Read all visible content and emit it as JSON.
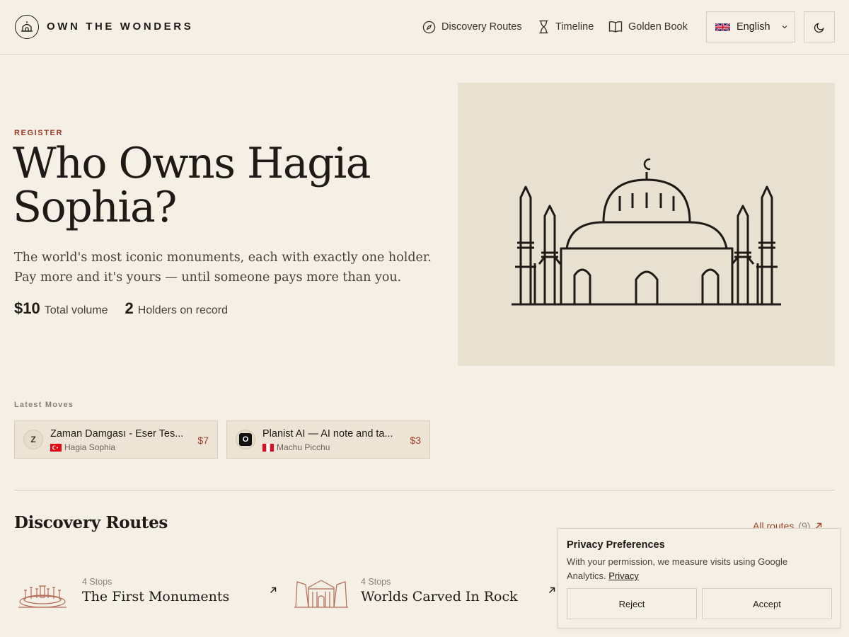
{
  "header": {
    "brand": "OWN THE WONDERS",
    "nav": [
      {
        "label": "Discovery Routes",
        "icon": "compass-icon"
      },
      {
        "label": "Timeline",
        "icon": "hourglass-icon"
      },
      {
        "label": "Golden Book",
        "icon": "book-icon"
      }
    ],
    "language": {
      "label": "English",
      "icon": "uk-flag-icon"
    },
    "theme_icon": "moon-icon"
  },
  "hero": {
    "eyebrow": "REGISTER",
    "title": "Who Owns Hagia Sophia?",
    "subtitle": "The world's most iconic monuments, each with exactly one holder. Pay more and it's yours — until someone pays more than you.",
    "stats": [
      {
        "value": "$10",
        "label": "Total volume"
      },
      {
        "value": "2",
        "label": "Holders on record"
      }
    ],
    "illustration": "hagia-sophia-illustration"
  },
  "latest_moves": {
    "label": "Latest Moves",
    "items": [
      {
        "avatar": "Z",
        "name": "Zaman Damgası - Eser Tes...",
        "place": "Hagia Sophia",
        "flag": "turkey-flag-icon",
        "price": "$7"
      },
      {
        "avatar": "O",
        "name": "Planist AI — AI note and ta...",
        "place": "Machu Picchu",
        "flag": "peru-flag-icon",
        "price": "$3"
      }
    ]
  },
  "routes": {
    "title": "Discovery Routes",
    "all_label": "All routes",
    "all_count": "(9)",
    "items": [
      {
        "stops": "4 Stops",
        "name": "The First Monuments"
      },
      {
        "stops": "4 Stops",
        "name": "Worlds Carved In Rock"
      }
    ]
  },
  "privacy": {
    "title": "Privacy Preferences",
    "text": "With your permission, we measure visits using Google Analytics.",
    "link": "Privacy",
    "reject": "Reject",
    "accept": "Accept"
  },
  "colors": {
    "background": "#f5f0e6",
    "accent": "#a04028",
    "text": "#1f1a15",
    "art_panel": "#e8e0d1"
  }
}
